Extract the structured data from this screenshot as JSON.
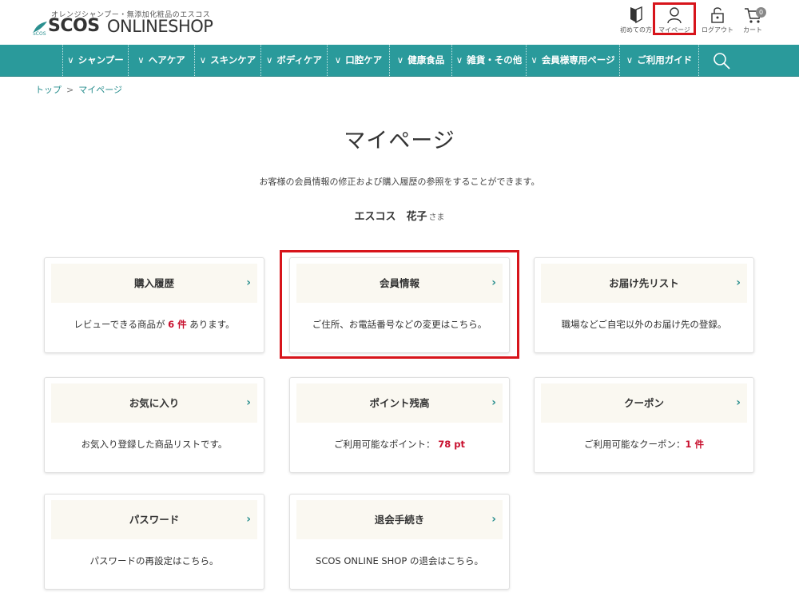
{
  "header": {
    "tagline": "オレンジシャンプー・無添加化粧品のエスコス",
    "logo_sub": "SCOS",
    "logo_main": "SCOS",
    "logo_rest": "ONLINESHOP",
    "icons": [
      {
        "label": "初めての方",
        "icon": "beginner-icon"
      },
      {
        "label": "マイページ",
        "icon": "user-icon"
      },
      {
        "label": "ログアウト",
        "icon": "logout-lock-icon"
      },
      {
        "label": "カート",
        "icon": "cart-icon"
      }
    ],
    "cart_count": "0"
  },
  "nav": {
    "items": [
      "シャンプー",
      "ヘアケア",
      "スキンケア",
      "ボディケア",
      "口腔ケア",
      "健康食品",
      "雑貨・その他",
      "会員様専用ページ",
      "ご利用ガイド"
    ],
    "chevron": "∨"
  },
  "breadcrumb": {
    "home": "トップ",
    "sep": ">",
    "current": "マイページ"
  },
  "main": {
    "title": "マイページ",
    "description": "お客様の会員情報の修正および購入履歴の参照をすることができます。",
    "user_name": "エスコス　花子",
    "user_suffix": "さま"
  },
  "cards": [
    {
      "title": "購入履歴",
      "body_pre": "レビューできる商品が ",
      "body_em": "6 件",
      "body_post": " あります。"
    },
    {
      "title": "会員情報",
      "body_pre": "ご住所、お電話番号などの変更はこちら。",
      "body_em": "",
      "body_post": ""
    },
    {
      "title": "お届け先リスト",
      "body_pre": "職場などご自宅以外のお届け先の登録。",
      "body_em": "",
      "body_post": ""
    },
    {
      "title": "お気に入り",
      "body_pre": "お気入り登録した商品リストです。",
      "body_em": "",
      "body_post": ""
    },
    {
      "title": "ポイント残高",
      "body_pre": "ご利用可能なポイント： ",
      "body_em": "78 pt",
      "body_post": ""
    },
    {
      "title": "クーポン",
      "body_pre": "ご利用可能なクーポン：",
      "body_em": "1 件",
      "body_post": ""
    },
    {
      "title": "パスワード",
      "body_pre": "パスワードの再設定はこちら。",
      "body_em": "",
      "body_post": ""
    },
    {
      "title": "退会手続き",
      "body_pre": "SCOS ONLINE SHOP の退会はこちら。",
      "body_em": "",
      "body_post": ""
    }
  ],
  "card_arrow": "›",
  "colors": {
    "accent": "#2a9a9b",
    "highlight": "#d7141b",
    "emphasis": "#c8102e",
    "card_head": "#faf8f1"
  }
}
